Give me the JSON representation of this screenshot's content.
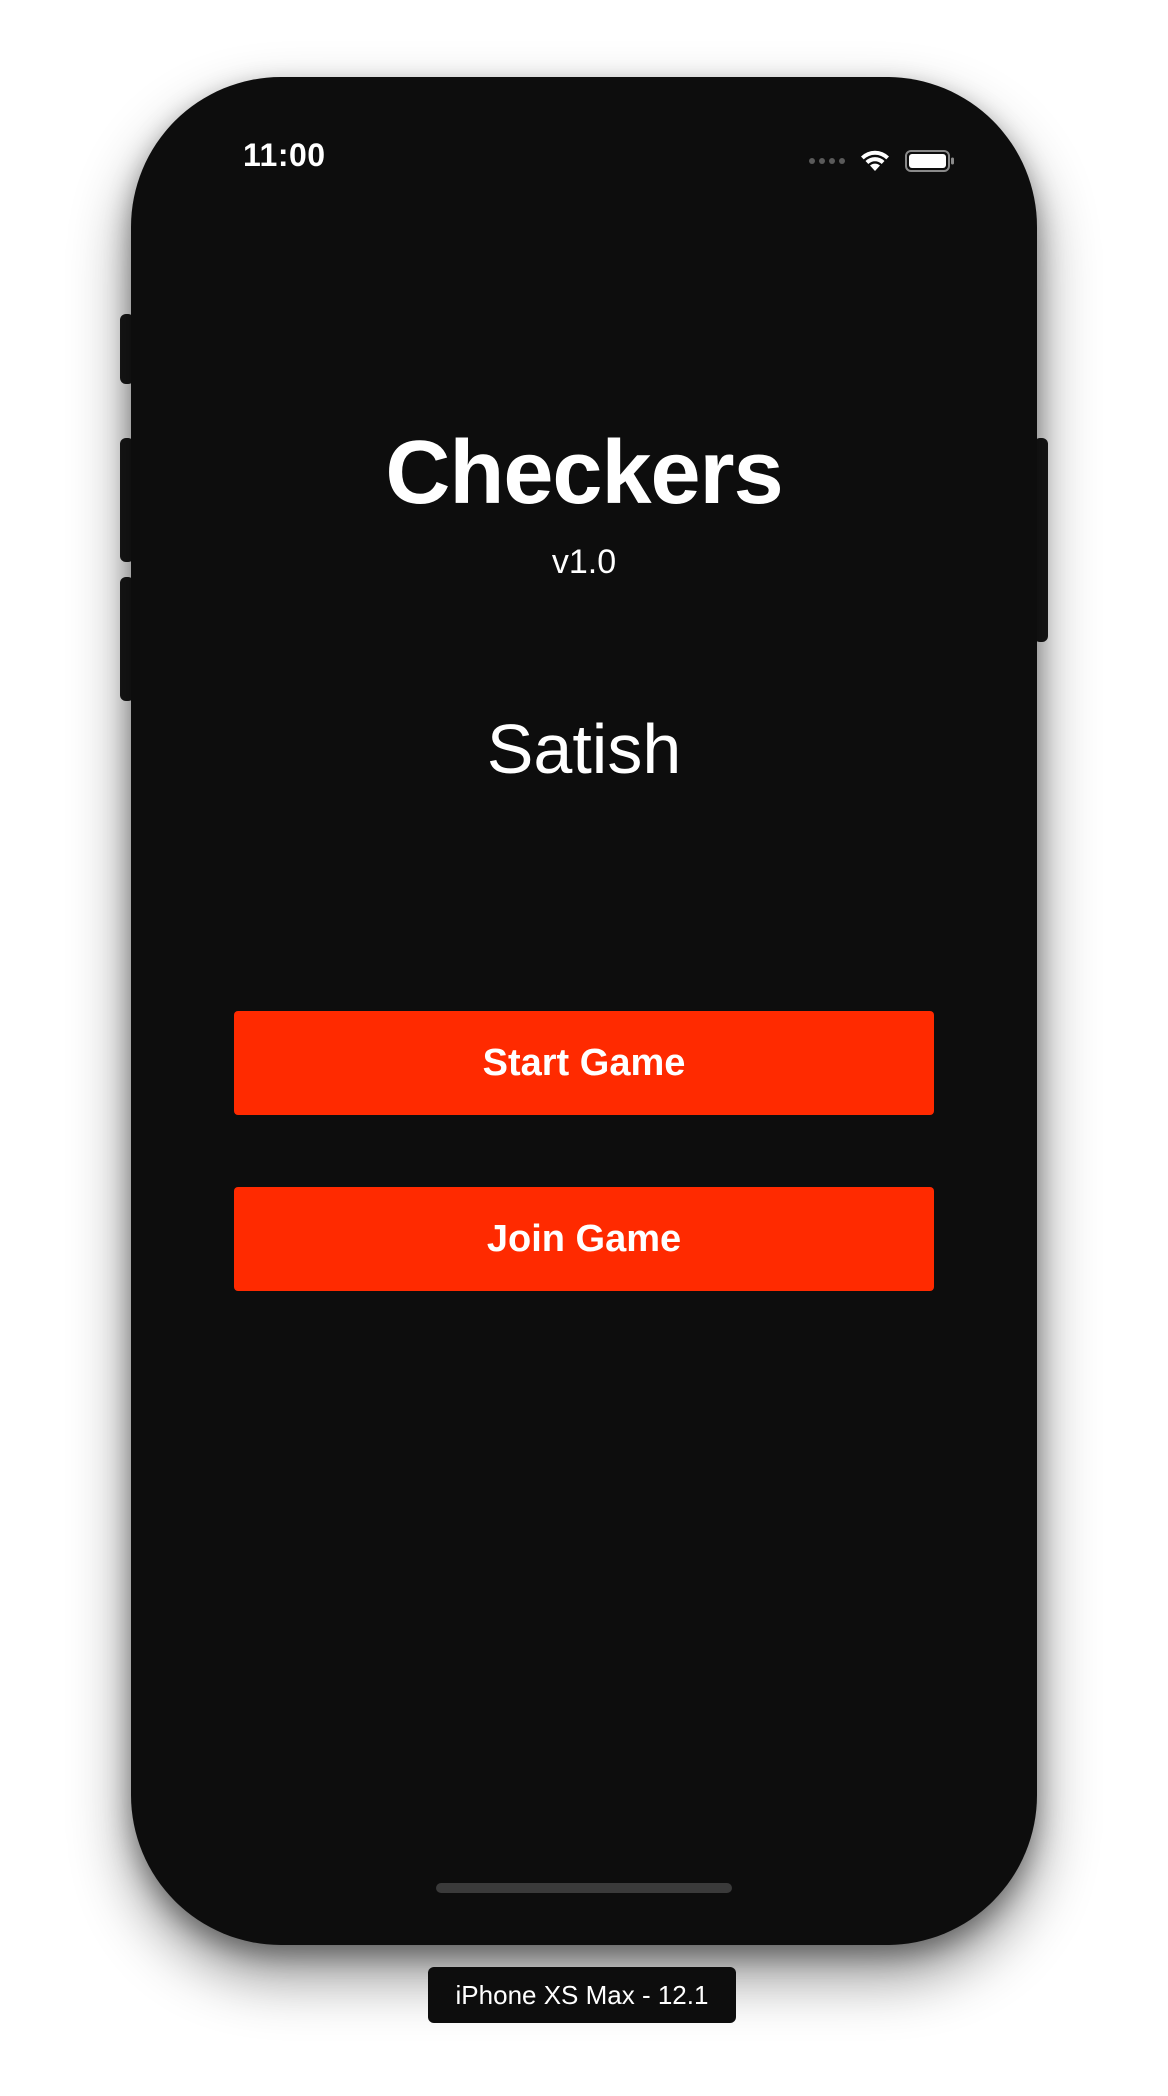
{
  "status_bar": {
    "time": "11:00",
    "icons": [
      "cellular-signal-icon",
      "wifi-icon",
      "battery-icon"
    ]
  },
  "app": {
    "title": "Checkers",
    "version": "v1.0",
    "player_name": "Satish"
  },
  "buttons": {
    "start_label": "Start Game",
    "join_label": "Join Game"
  },
  "simulator": {
    "device_label": "iPhone XS Max - 12.1"
  },
  "colors": {
    "accent": "#ff2a00",
    "background": "#0d0d0d",
    "text": "#ffffff"
  }
}
